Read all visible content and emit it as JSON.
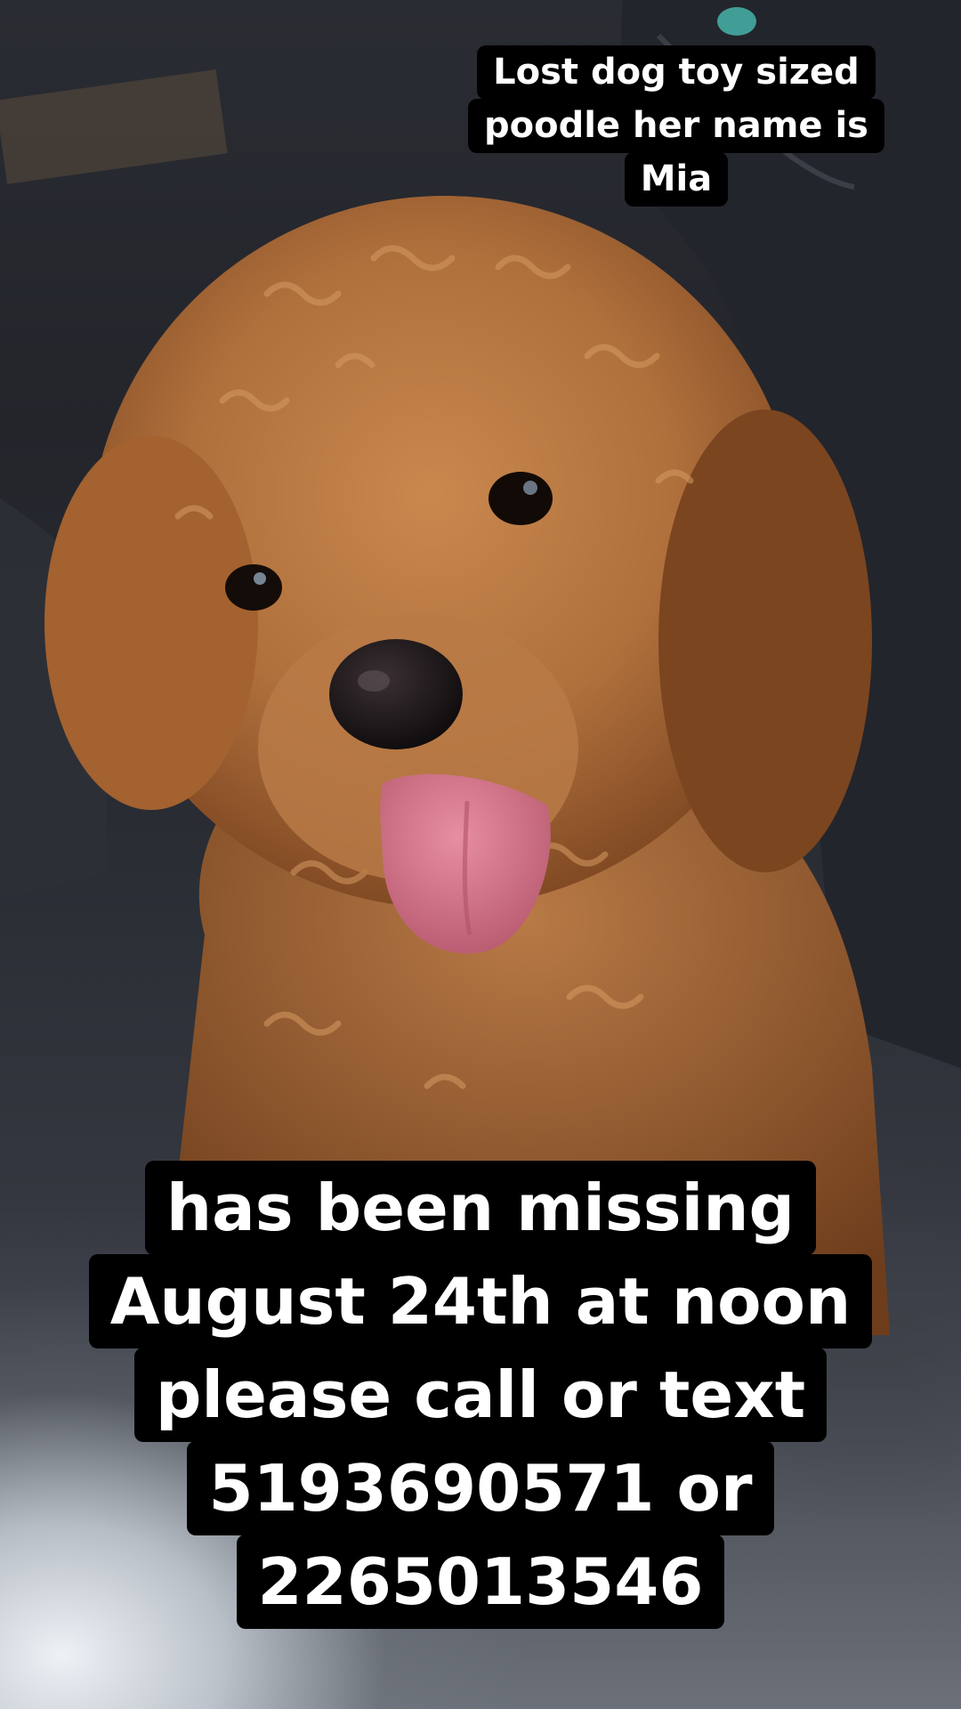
{
  "overlay_text": {
    "top_caption": [
      "Lost dog toy sized",
      "poodle her name is",
      "Mia"
    ],
    "bottom_caption": [
      "has been missing",
      "August 24th at noon",
      "please call or text",
      "5193690571 or",
      "2265013546"
    ]
  },
  "colors": {
    "caption_background": "#000000",
    "caption_text": "#ffffff",
    "fur": "#b0703c",
    "tongue": "#d8788f"
  }
}
